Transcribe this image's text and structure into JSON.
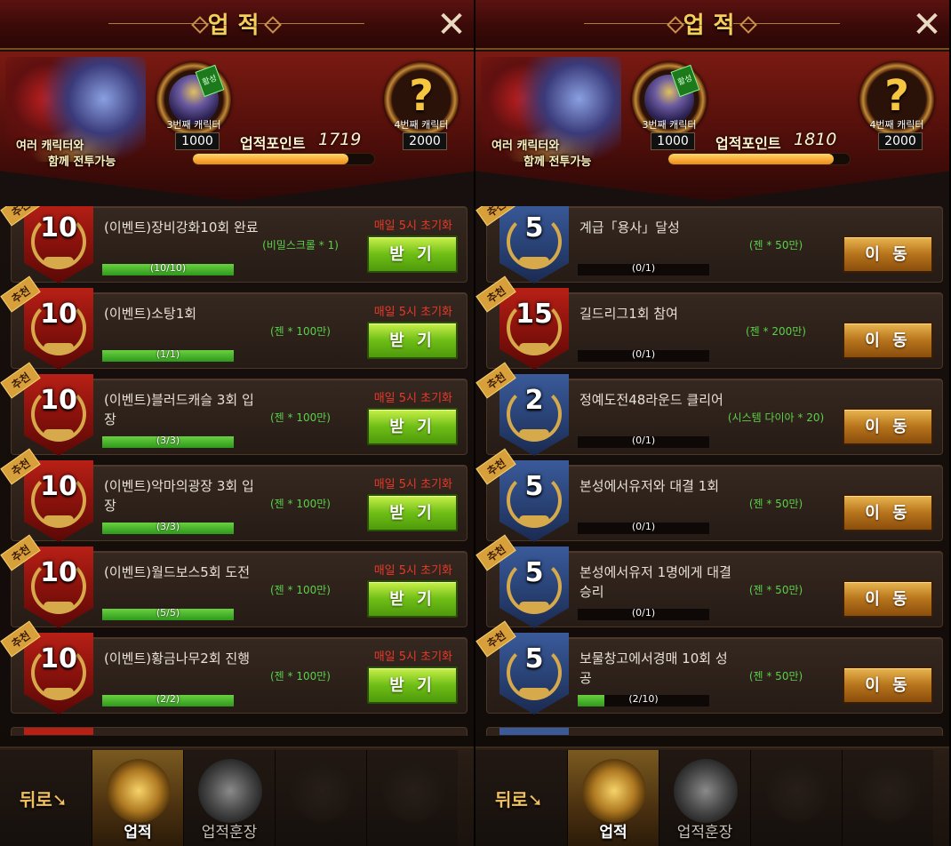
{
  "panels": [
    {
      "title": "업적",
      "header": {
        "hero_line1": "여러 캐릭터와",
        "hero_line2": "함께 전투가능",
        "tag": "활성",
        "milestone3_label": "3번째 캐릭터",
        "milestone3_value": "1000",
        "milestone4_label": "4번째 캐릭터",
        "milestone4_value": "2000",
        "milestone4_symbol": "?",
        "points_label": "업적포인트",
        "points_value": "1719",
        "points_progress": 0.86
      },
      "rows": [
        {
          "badge": "추천",
          "emblem_color": "red",
          "level": "10",
          "title": "(이벤트)장비강화10회 완료",
          "reward": "(비밀스크롤 * 1)",
          "reset": "매일 5시 초기화",
          "progress_text": "(10/10)",
          "progress": 1.0,
          "button": "받 기",
          "button_type": "recv"
        },
        {
          "badge": "추천",
          "emblem_color": "red",
          "level": "10",
          "title": "(이벤트)소탕1회",
          "reward": "(젠 * 100만)",
          "reset": "매일 5시 초기화",
          "progress_text": "(1/1)",
          "progress": 1.0,
          "button": "받 기",
          "button_type": "recv"
        },
        {
          "badge": "추천",
          "emblem_color": "red",
          "level": "10",
          "title": "(이벤트)블러드캐슬 3회 입장",
          "reward": "(젠 * 100만)",
          "reset": "매일 5시 초기화",
          "progress_text": "(3/3)",
          "progress": 1.0,
          "button": "받 기",
          "button_type": "recv"
        },
        {
          "badge": "추천",
          "emblem_color": "red",
          "level": "10",
          "title": "(이벤트)악마의광장 3회 입장",
          "reward": "(젠 * 100만)",
          "reset": "매일 5시 초기화",
          "progress_text": "(3/3)",
          "progress": 1.0,
          "button": "받 기",
          "button_type": "recv"
        },
        {
          "badge": "추천",
          "emblem_color": "red",
          "level": "10",
          "title": "(이벤트)월드보스5회 도전",
          "reward": "(젠 * 100만)",
          "reset": "매일 5시 초기화",
          "progress_text": "(5/5)",
          "progress": 1.0,
          "button": "받 기",
          "button_type": "recv"
        },
        {
          "badge": "추천",
          "emblem_color": "red",
          "level": "10",
          "title": "(이벤트)황금나무2회 진행",
          "reward": "(젠 * 100만)",
          "reset": "매일 5시 초기화",
          "progress_text": "(2/2)",
          "progress": 1.0,
          "button": "받 기",
          "button_type": "recv"
        }
      ],
      "peek_color": "red",
      "nav": {
        "back": "뒤로",
        "tab1": "업적",
        "tab2": "업적훈장"
      }
    },
    {
      "title": "업적",
      "header": {
        "hero_line1": "여러 캐릭터와",
        "hero_line2": "함께 전투가능",
        "tag": "활성",
        "milestone3_label": "3번째 캐릭터",
        "milestone3_value": "1000",
        "milestone4_label": "4번째 캐릭터",
        "milestone4_value": "2000",
        "milestone4_symbol": "?",
        "points_label": "업적포인트",
        "points_value": "1810",
        "points_progress": 0.91
      },
      "rows": [
        {
          "badge": "추천",
          "emblem_color": "blue",
          "level": "5",
          "title": "계급「용사」달성",
          "reward": "(젠 * 50만)",
          "reset": "",
          "progress_text": "(0/1)",
          "progress": 0.0,
          "button": "이 동",
          "button_type": "move"
        },
        {
          "badge": "추천",
          "emblem_color": "red",
          "level": "15",
          "title": "길드리그1회 참여",
          "reward": "(젠 * 200만)",
          "reset": "",
          "progress_text": "(0/1)",
          "progress": 0.0,
          "button": "이 동",
          "button_type": "move"
        },
        {
          "badge": "추천",
          "emblem_color": "blue",
          "level": "2",
          "title": "정예도전48라운드 클리어",
          "reward": "(시스템 다이아 * 20)",
          "reset": "",
          "progress_text": "(0/1)",
          "progress": 0.0,
          "button": "이 동",
          "button_type": "move"
        },
        {
          "badge": "추천",
          "emblem_color": "blue",
          "level": "5",
          "title": "본성에서유저와 대결 1회",
          "reward": "(젠 * 50만)",
          "reset": "",
          "progress_text": "(0/1)",
          "progress": 0.0,
          "button": "이 동",
          "button_type": "move"
        },
        {
          "badge": "추천",
          "emblem_color": "blue",
          "level": "5",
          "title": "본성에서유저 1명에게 대결 승리",
          "reward": "(젠 * 50만)",
          "reset": "",
          "progress_text": "(0/1)",
          "progress": 0.0,
          "button": "이 동",
          "button_type": "move"
        },
        {
          "badge": "추천",
          "emblem_color": "blue",
          "level": "5",
          "title": "보물창고에서경매 10회 성공",
          "reward": "(젠 * 50만)",
          "reset": "",
          "progress_text": "(2/10)",
          "progress": 0.2,
          "button": "이 동",
          "button_type": "move"
        }
      ],
      "peek_color": "blue",
      "nav": {
        "back": "뒤로",
        "tab1": "업적",
        "tab2": "업적훈장"
      }
    }
  ],
  "colors": {
    "reward_green": "#5ad04a",
    "reset_red": "#e63a2a",
    "title_gold": "#f6cf5a",
    "recv_button": "#6fbe16",
    "move_button": "#b7741c"
  },
  "icons": {
    "close": "close-icon",
    "back_arrow": "back-arrow-icon",
    "achievement_tab": "trophy-icon",
    "medal_tab": "medal-icon",
    "wreath": "laurel-wreath-icon"
  }
}
